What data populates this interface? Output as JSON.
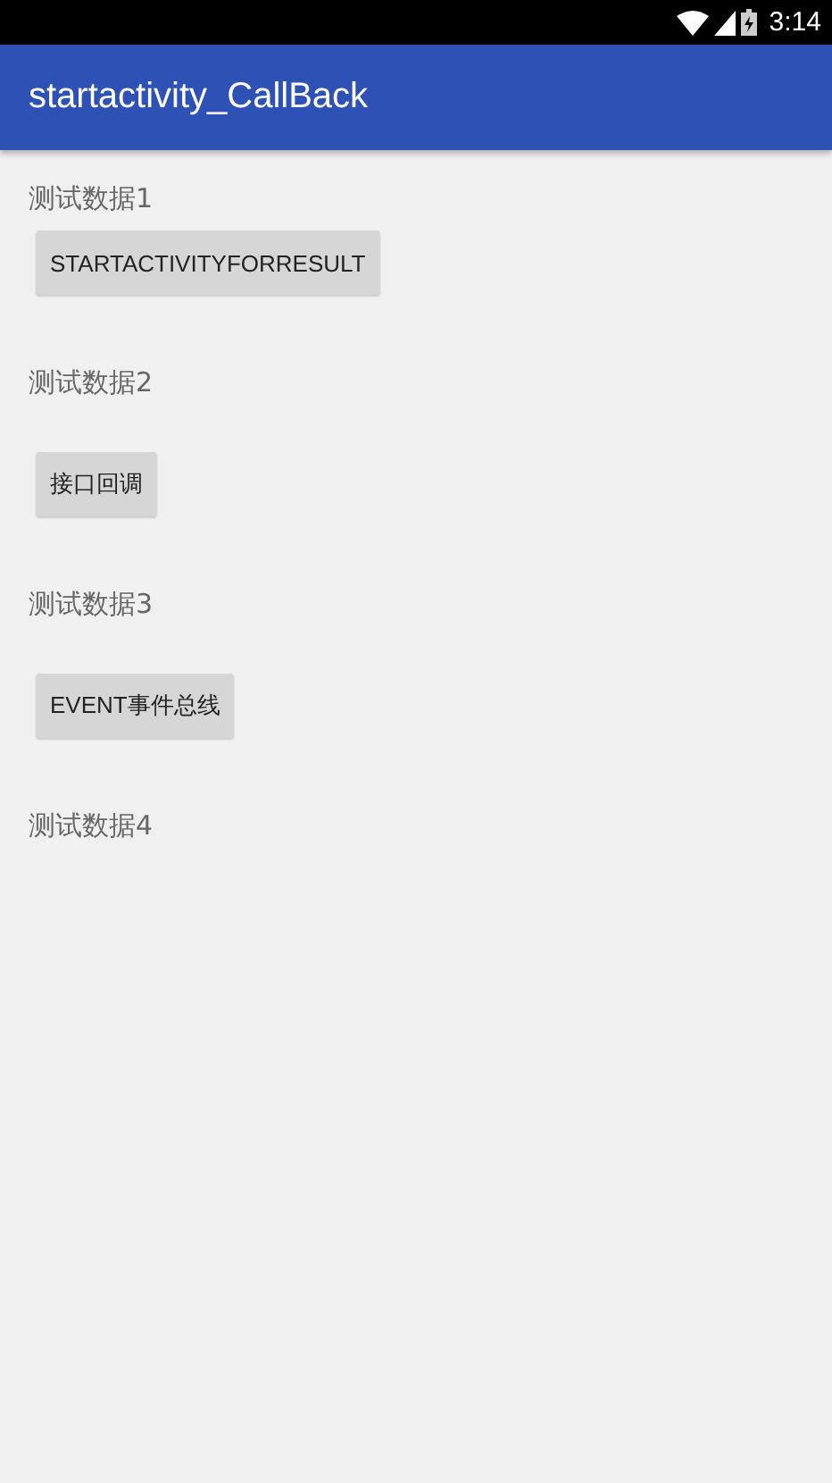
{
  "status_bar": {
    "time": "3:14"
  },
  "app_bar": {
    "title": "startactivity_CallBack"
  },
  "sections": [
    {
      "label": "测试数据1",
      "button": "STARTACTIVITYFORRESULT"
    },
    {
      "label": "测试数据2",
      "button": "接口回调"
    },
    {
      "label": "测试数据3",
      "button": "EVENT事件总线"
    },
    {
      "label": "测试数据4"
    }
  ]
}
